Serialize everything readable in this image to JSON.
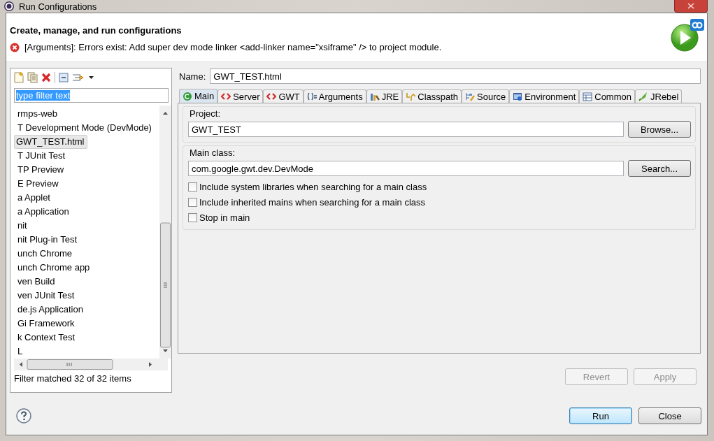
{
  "window": {
    "title": "Run Configurations"
  },
  "header": {
    "title": "Create, manage, and run configurations",
    "message": "[Arguments]: Errors exist: Add super dev mode linker <add-linker name=\"xsiframe\" /> to project module."
  },
  "filter": {
    "value": "type filter text",
    "text_selected": true
  },
  "tree": [
    {
      "label": "rmps-web",
      "selected": false
    },
    {
      "label": "T Development Mode (DevMode)",
      "selected": false,
      "children": [
        {
          "label": "GWT_TEST.html",
          "selected": true
        }
      ]
    },
    {
      "label": "T JUnit Test",
      "selected": false
    },
    {
      "label": "TP Preview",
      "selected": false
    },
    {
      "label": "E Preview",
      "selected": false
    },
    {
      "label": "a Applet",
      "selected": false
    },
    {
      "label": "a Application",
      "selected": false
    },
    {
      "label": "nit",
      "selected": false
    },
    {
      "label": "nit Plug-in Test",
      "selected": false
    },
    {
      "label": "unch Chrome",
      "selected": false
    },
    {
      "label": "unch Chrome app",
      "selected": false
    },
    {
      "label": "ven Build",
      "selected": false
    },
    {
      "label": "ven JUnit Test",
      "selected": false
    },
    {
      "label": "de.js Application",
      "selected": false
    },
    {
      "label": "Gi Framework",
      "selected": false
    },
    {
      "label": "k Context Test",
      "selected": false
    },
    {
      "label": "L",
      "selected": false
    }
  ],
  "filter_status": "Filter matched 32 of 32 items",
  "name_field": {
    "label": "Name:",
    "value": "GWT_TEST.html"
  },
  "tabs": [
    {
      "label": "Main",
      "selected": true
    },
    {
      "label": "Server",
      "selected": false
    },
    {
      "label": "GWT",
      "selected": false
    },
    {
      "label": "Arguments",
      "selected": false
    },
    {
      "label": "JRE",
      "selected": false
    },
    {
      "label": "Classpath",
      "selected": false
    },
    {
      "label": "Source",
      "selected": false
    },
    {
      "label": "Environment",
      "selected": false
    },
    {
      "label": "Common",
      "selected": false
    },
    {
      "label": "JRebel",
      "selected": false
    }
  ],
  "project": {
    "label": "Project:",
    "value": "GWT_TEST",
    "button": "Browse..."
  },
  "main_class": {
    "label": "Main class:",
    "value": "com.google.gwt.dev.DevMode",
    "button": "Search..."
  },
  "options": [
    {
      "label": "Include system libraries when searching for a main class",
      "checked": false
    },
    {
      "label": "Include inherited mains when searching for a main class",
      "checked": false
    },
    {
      "label": "Stop in main",
      "checked": false
    }
  ],
  "config_buttons": [
    {
      "label": "Revert",
      "disabled": true
    },
    {
      "label": "Apply",
      "disabled": true
    }
  ],
  "dialog_buttons": [
    {
      "label": "Run",
      "default": true
    },
    {
      "label": "Close",
      "default": false
    }
  ]
}
